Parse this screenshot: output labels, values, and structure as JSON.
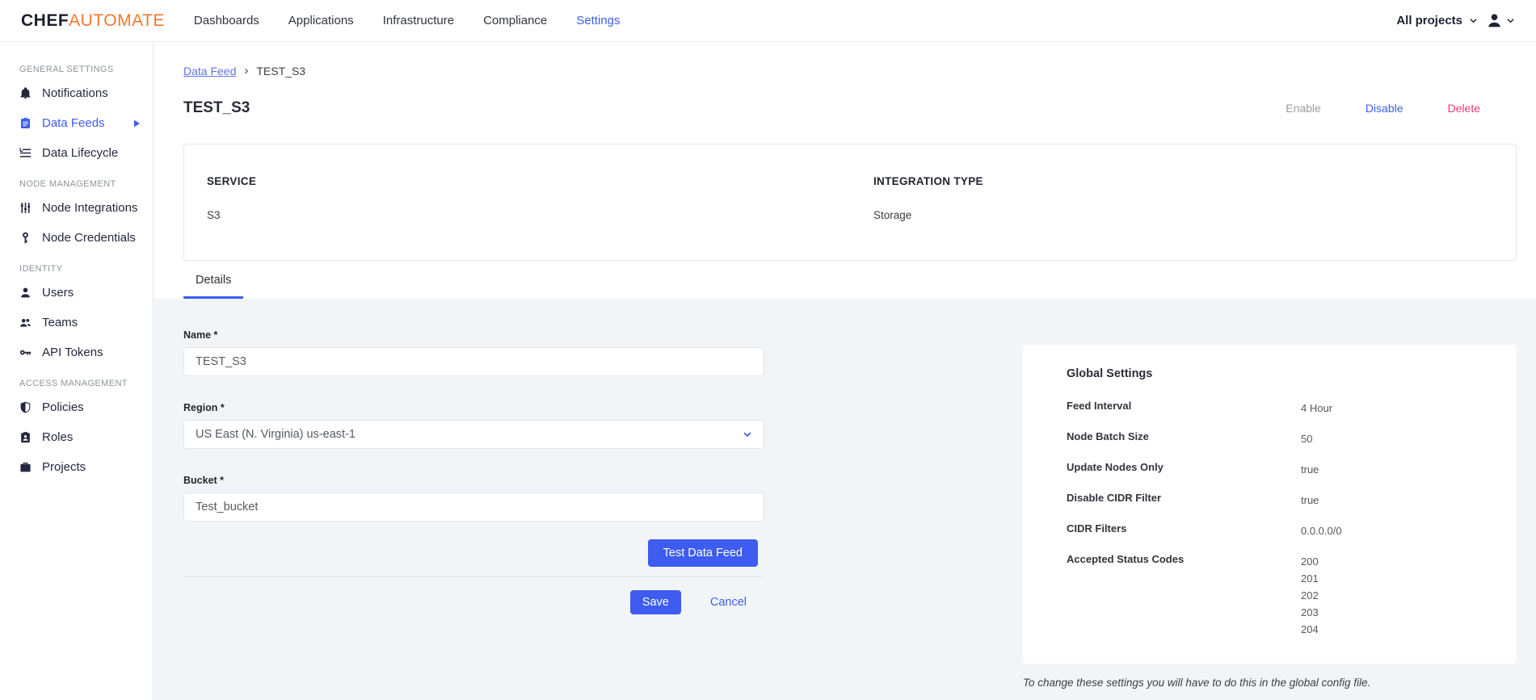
{
  "colors": {
    "accent": "#3e5cf0",
    "brand-orange": "#f7772b",
    "navy": "#23253a",
    "danger": "#ee3d77",
    "muted": "#9b9ca3",
    "bg-gray": "#f2f5f7",
    "border": "#e3e7eb"
  },
  "header": {
    "logo_chef": "CHEF",
    "logo_automate": "AUTOMATE",
    "nav": [
      {
        "label": "Dashboards"
      },
      {
        "label": "Applications"
      },
      {
        "label": "Infrastructure"
      },
      {
        "label": "Compliance"
      },
      {
        "label": "Settings"
      }
    ],
    "projects_filter": "All projects"
  },
  "sidebar": {
    "sections": [
      {
        "heading": "GENERAL SETTINGS",
        "items": [
          {
            "label": "Notifications",
            "icon": "bell-icon"
          },
          {
            "label": "Data Feeds",
            "icon": "clipboard-icon",
            "active": true,
            "has_submenu": true
          },
          {
            "label": "Data Lifecycle",
            "icon": "lifecycle-icon"
          }
        ]
      },
      {
        "heading": "NODE MANAGEMENT",
        "items": [
          {
            "label": "Node Integrations",
            "icon": "sliders-icon"
          },
          {
            "label": "Node Credentials",
            "icon": "key-icon"
          }
        ]
      },
      {
        "heading": "IDENTITY",
        "items": [
          {
            "label": "Users",
            "icon": "user-icon"
          },
          {
            "label": "Teams",
            "icon": "people-icon"
          },
          {
            "label": "API Tokens",
            "icon": "token-key-icon"
          }
        ]
      },
      {
        "heading": "ACCESS MANAGEMENT",
        "items": [
          {
            "label": "Policies",
            "icon": "shield-icon"
          },
          {
            "label": "Roles",
            "icon": "badge-icon"
          },
          {
            "label": "Projects",
            "icon": "briefcase-icon"
          }
        ]
      }
    ]
  },
  "breadcrumb": {
    "link": "Data Feed",
    "separator": "›",
    "current": "TEST_S3"
  },
  "page": {
    "title": "TEST_S3",
    "actions": {
      "enable": "Enable",
      "disable": "Disable",
      "delete": "Delete"
    }
  },
  "summary_card": {
    "columns": [
      {
        "label": "SERVICE",
        "value": "S3"
      },
      {
        "label": "INTEGRATION TYPE",
        "value": "Storage"
      }
    ]
  },
  "tabs": [
    {
      "label": "Details",
      "active": true
    }
  ],
  "form": {
    "fields": [
      {
        "label": "Name *",
        "value": "TEST_S3",
        "type": "text"
      },
      {
        "label": "Region *",
        "value": "US East (N. Virginia) us-east-1",
        "type": "select"
      },
      {
        "label": "Bucket *",
        "value": "Test_bucket",
        "type": "text"
      }
    ],
    "test_button": "Test Data Feed",
    "save_button": "Save",
    "cancel_link": "Cancel"
  },
  "global_settings": {
    "title": "Global Settings",
    "rows": [
      {
        "label": "Feed Interval",
        "values": [
          "4 Hour"
        ]
      },
      {
        "label": "Node Batch Size",
        "values": [
          "50"
        ]
      },
      {
        "label": "Update Nodes Only",
        "values": [
          "true"
        ]
      },
      {
        "label": "Disable CIDR Filter",
        "values": [
          "true"
        ]
      },
      {
        "label": "CIDR Filters",
        "values": [
          "0.0.0.0/0"
        ]
      },
      {
        "label": "Accepted Status Codes",
        "values": [
          "200",
          "201",
          "202",
          "203",
          "204"
        ]
      }
    ],
    "footnote": "To change these settings you will have to do this in the global config file."
  }
}
